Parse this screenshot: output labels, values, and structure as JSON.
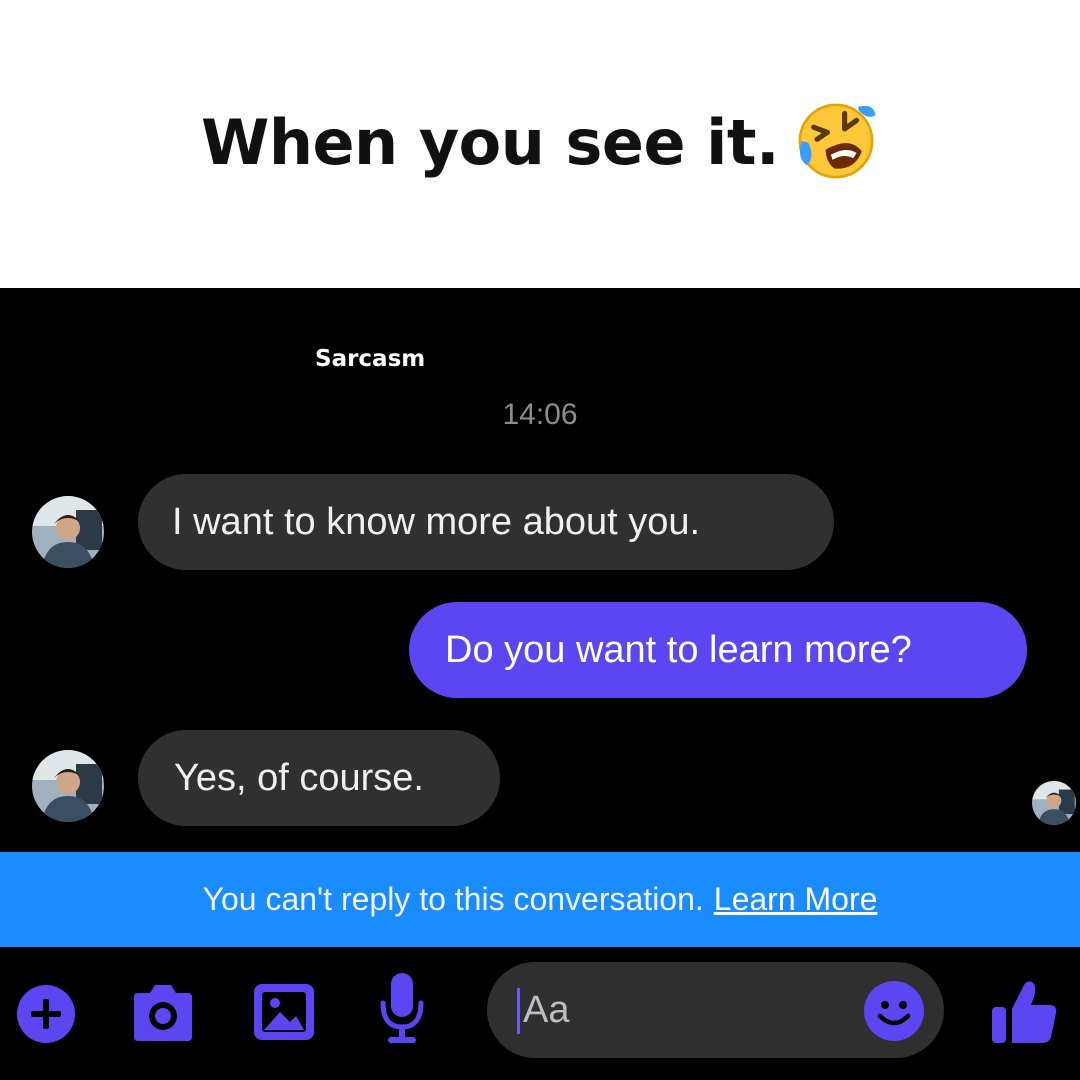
{
  "caption": {
    "text": "When you see it."
  },
  "chat": {
    "page_tag": "Sarcasm",
    "timestamp": "14:06",
    "messages": [
      {
        "direction": "incoming",
        "text": "I want to know more about you."
      },
      {
        "direction": "outgoing",
        "text": "Do you want to learn more?"
      },
      {
        "direction": "incoming",
        "text": "Yes, of course."
      }
    ],
    "banner": {
      "text": "You can't reply to this conversation.",
      "link": "Learn More"
    },
    "composer": {
      "placeholder": "Aa",
      "icons": [
        "plus-icon",
        "camera-icon",
        "photo-icon",
        "microphone-icon",
        "emoji-icon",
        "thumbs-up-icon"
      ]
    }
  },
  "colors": {
    "accent": "#5b46f2",
    "banner": "#1a8cff",
    "incoming_bubble": "#303030",
    "chat_background": "#000000"
  }
}
